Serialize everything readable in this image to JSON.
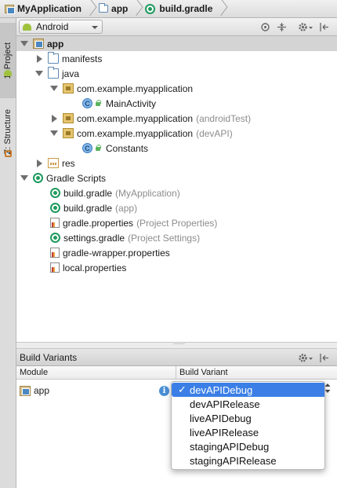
{
  "breadcrumb": [
    {
      "label": "MyApplication",
      "icon": "module-icon"
    },
    {
      "label": "app",
      "icon": "folder-icon"
    },
    {
      "label": "build.gradle",
      "icon": "gradle-icon"
    }
  ],
  "side_tabs": {
    "project": "1: Project",
    "structure": "Z: Structure"
  },
  "project_panel": {
    "view_mode": "Android",
    "tree": [
      {
        "label": "app",
        "level": 0,
        "expanded": true,
        "icon": "module",
        "bold": true
      },
      {
        "label": "manifests",
        "level": 1,
        "expanded": false,
        "icon": "folder"
      },
      {
        "label": "java",
        "level": 1,
        "expanded": true,
        "icon": "folder"
      },
      {
        "label": "com.example.myapplication",
        "level": 2,
        "expanded": true,
        "icon": "package"
      },
      {
        "label": "MainActivity",
        "level": 3,
        "icon": "class"
      },
      {
        "label": "com.example.myapplication",
        "suffix": "(androidTest)",
        "level": 2,
        "expanded": false,
        "icon": "package"
      },
      {
        "label": "com.example.myapplication",
        "suffix": "(devAPI)",
        "level": 2,
        "expanded": true,
        "icon": "package"
      },
      {
        "label": "Constants",
        "level": 3,
        "icon": "class"
      },
      {
        "label": "res",
        "level": 1,
        "expanded": false,
        "icon": "res"
      },
      {
        "label": "Gradle Scripts",
        "level": 0,
        "expanded": true,
        "icon": "gradle-scripts"
      },
      {
        "label": "build.gradle",
        "suffix": "(MyApplication)",
        "level": 1,
        "icon": "gradle"
      },
      {
        "label": "build.gradle",
        "suffix": "(app)",
        "level": 1,
        "icon": "gradle"
      },
      {
        "label": "gradle.properties",
        "suffix": "(Project Properties)",
        "level": 1,
        "icon": "properties"
      },
      {
        "label": "settings.gradle",
        "suffix": "(Project Settings)",
        "level": 1,
        "icon": "gradle"
      },
      {
        "label": "gradle-wrapper.properties",
        "level": 1,
        "icon": "properties"
      },
      {
        "label": "local.properties",
        "level": 1,
        "icon": "properties"
      }
    ]
  },
  "build_variants": {
    "title": "Build Variants",
    "col_module": "Module",
    "col_variant": "Build Variant",
    "rows": [
      {
        "module": "app",
        "variant": "devAPIDebug"
      }
    ],
    "options": [
      "devAPIDebug",
      "devAPIRelease",
      "liveAPIDebug",
      "liveAPIRelease",
      "stagingAPIDebug",
      "stagingAPIRelease"
    ],
    "selected": "devAPIDebug",
    "check_glyph": "✓"
  },
  "colors": {
    "selection": "#3b7fe6",
    "gradle_green": "#1f9a5d",
    "muted_text": "#8c8c8c"
  }
}
